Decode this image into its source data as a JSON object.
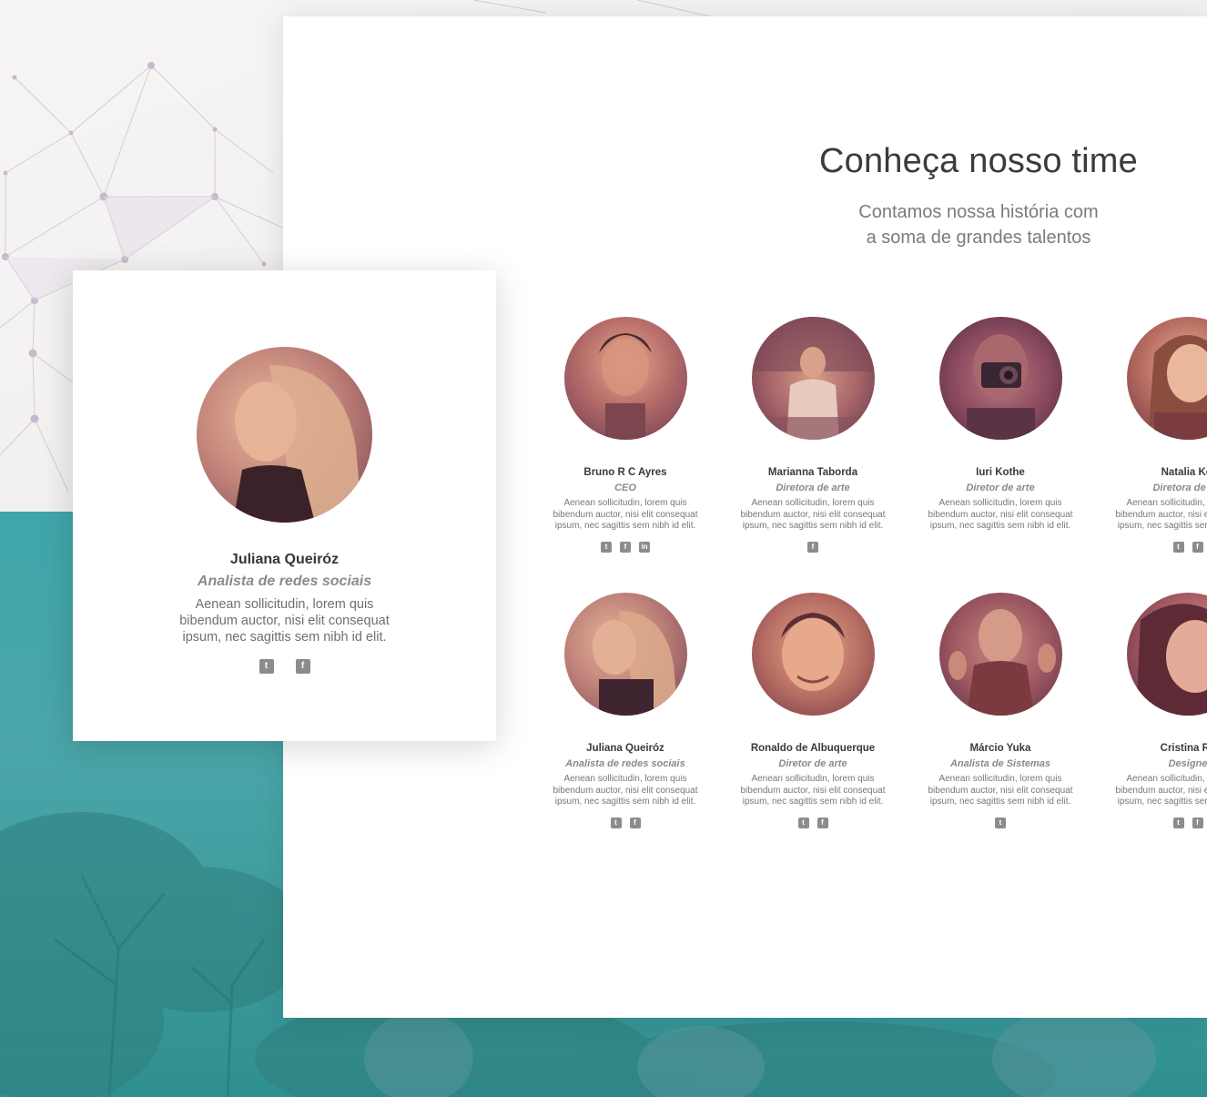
{
  "header": {
    "title": "Conheça nosso time",
    "subtitle_line1": "Contamos nossa história com",
    "subtitle_line2": "a soma de grandes talentos"
  },
  "featured": {
    "name": "Juliana Queiróz",
    "role": "Analista de redes sociais",
    "desc_line1": "Aenean sollicitudin, lorem quis",
    "desc_line2": "bibendum auctor, nisi elit consequat",
    "desc_line3": "ipsum, nec sagittis sem nibh id elit.",
    "social": [
      "twitter-icon",
      "facebook-icon"
    ]
  },
  "members": [
    {
      "name": "Bruno R C Ayres",
      "role": "CEO",
      "social": [
        "twitter-icon",
        "facebook-icon",
        "linkedin-icon"
      ]
    },
    {
      "name": "Marianna Taborda",
      "role": "Diretora de arte",
      "social": [
        "facebook-icon"
      ]
    },
    {
      "name": "Iuri Kothe",
      "role": "Diretor de arte",
      "social": []
    },
    {
      "name": "Natalia Kel",
      "role": "Diretora de ma",
      "social": [
        "twitter-icon",
        "facebook-icon"
      ]
    },
    {
      "name": "Juliana Queiróz",
      "role": "Analista de redes sociais",
      "social": [
        "twitter-icon",
        "facebook-icon"
      ]
    },
    {
      "name": "Ronaldo de Albuquerque",
      "role": "Diretor de arte",
      "social": [
        "twitter-icon",
        "facebook-icon"
      ]
    },
    {
      "name": "Márcio Yuka",
      "role": "Analista de Sistemas",
      "social": [
        "twitter-icon"
      ]
    },
    {
      "name": "Cristina Ra",
      "role": "Designe",
      "social": [
        "twitter-icon",
        "facebook-icon"
      ]
    }
  ],
  "desc": {
    "line1": "Aenean sollicitudin, lorem quis",
    "line2": "bibendum auctor, nisi elit consequat",
    "line3": "ipsum, nec sagittis sem nibh id elit."
  },
  "colors": {
    "accent_teal": "#3fa6ab",
    "avatar_tint": "#9b4a5a",
    "icon_gray": "#8c8c8c"
  }
}
